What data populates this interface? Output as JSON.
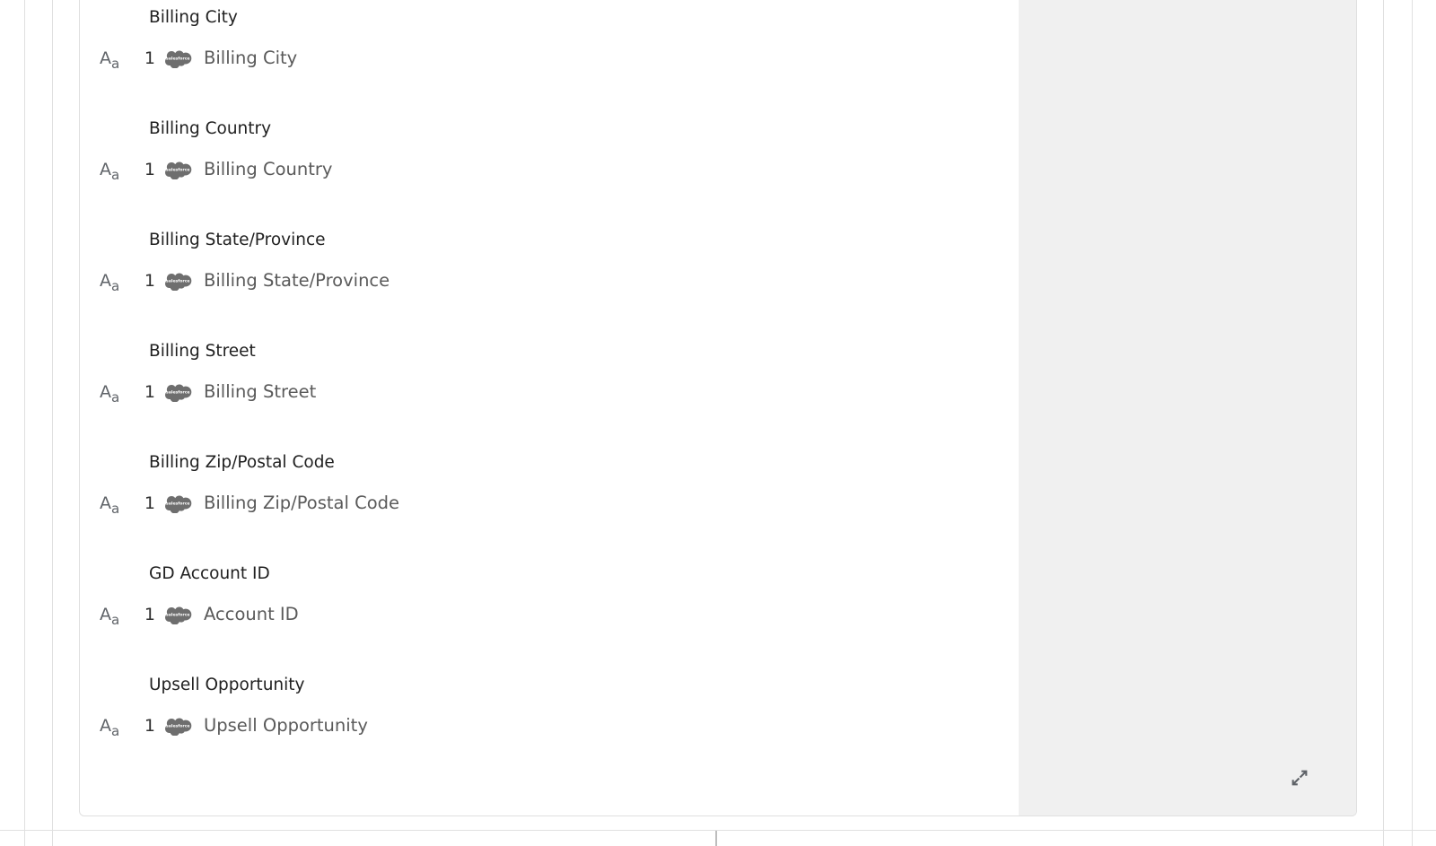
{
  "panel": {
    "preview_pane_bg": "#f0f0f0",
    "expand_icon": "expand-arrows-icon"
  },
  "colors": {
    "source_label": "#212121",
    "target_label": "#5a5a5a",
    "sequence_number": "#303030",
    "type_icon": "#5f6368",
    "salesforce_logo": "#6e6e6e",
    "card_border": "#e0e0e0",
    "preview_bg": "#f0f0f0"
  },
  "field_mappings": [
    {
      "source_label": "Billing City",
      "type_icon": "text-type-icon",
      "type_icon_big": "A",
      "type_icon_small": "a",
      "sequence": "1",
      "system_icon": "salesforce-logo",
      "system_name": "salesforce",
      "target_label": "Billing City"
    },
    {
      "source_label": "Billing Country",
      "type_icon": "text-type-icon",
      "type_icon_big": "A",
      "type_icon_small": "a",
      "sequence": "1",
      "system_icon": "salesforce-logo",
      "system_name": "salesforce",
      "target_label": "Billing Country"
    },
    {
      "source_label": "Billing State/Province",
      "type_icon": "text-type-icon",
      "type_icon_big": "A",
      "type_icon_small": "a",
      "sequence": "1",
      "system_icon": "salesforce-logo",
      "system_name": "salesforce",
      "target_label": "Billing State/Province"
    },
    {
      "source_label": "Billing Street",
      "type_icon": "text-type-icon",
      "type_icon_big": "A",
      "type_icon_small": "a",
      "sequence": "1",
      "system_icon": "salesforce-logo",
      "system_name": "salesforce",
      "target_label": "Billing Street"
    },
    {
      "source_label": "Billing Zip/Postal Code",
      "type_icon": "text-type-icon",
      "type_icon_big": "A",
      "type_icon_small": "a",
      "sequence": "1",
      "system_icon": "salesforce-logo",
      "system_name": "salesforce",
      "target_label": "Billing Zip/Postal Code"
    },
    {
      "source_label": "GD Account ID",
      "type_icon": "text-type-icon",
      "type_icon_big": "A",
      "type_icon_small": "a",
      "sequence": "1",
      "system_icon": "salesforce-logo",
      "system_name": "salesforce",
      "target_label": "Account ID"
    },
    {
      "source_label": "Upsell Opportunity",
      "type_icon": "text-type-icon",
      "type_icon_big": "A",
      "type_icon_small": "a",
      "sequence": "1",
      "system_icon": "salesforce-logo",
      "system_name": "salesforce",
      "target_label": "Upsell Opportunity"
    }
  ]
}
